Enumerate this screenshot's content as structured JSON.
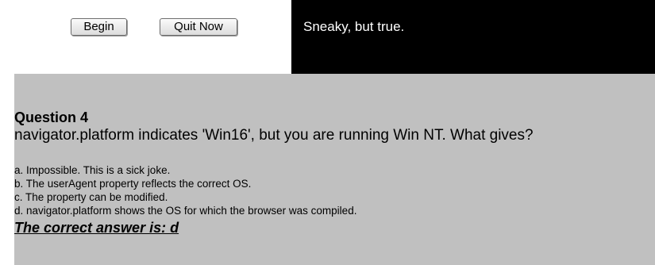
{
  "controls": {
    "begin_label": "Begin",
    "quit_label": "Quit Now"
  },
  "feedback": {
    "text": "Sneaky, but true."
  },
  "question": {
    "number_label": "Question 4",
    "text": "navigator.platform indicates 'Win16', but you are running Win NT. What gives?",
    "options": [
      "a. Impossible. This is a sick joke.",
      "b. The userAgent property reflects the correct OS.",
      "c. The property can be modified.",
      "d. navigator.platform shows the OS for which the browser was compiled."
    ],
    "answer": "The correct answer is: d"
  },
  "colors": {
    "feedback_background": "#000000",
    "question_background": "#c0c0c0"
  }
}
